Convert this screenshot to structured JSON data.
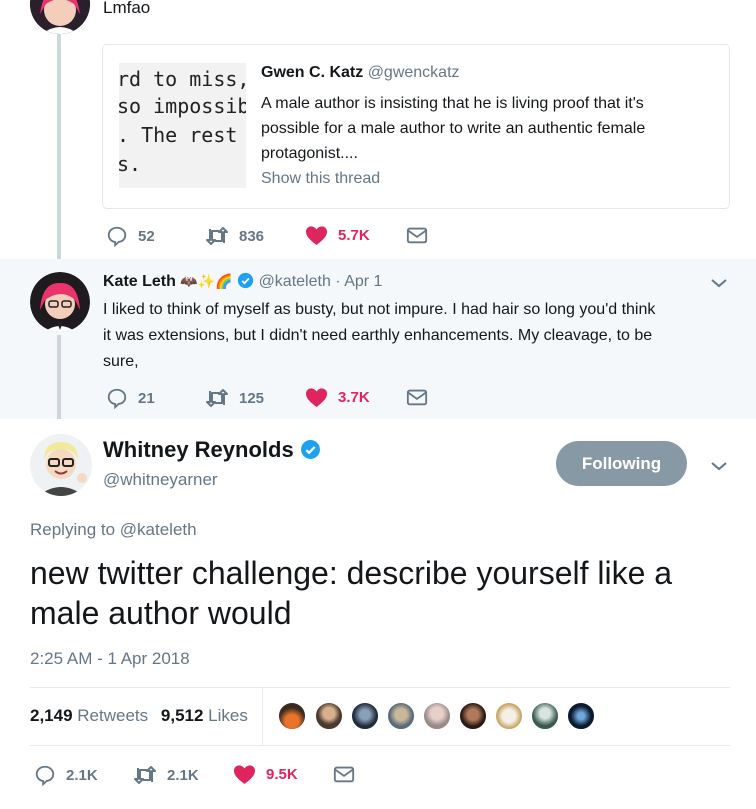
{
  "top_tweet": {
    "text": "Lmfao",
    "quote": {
      "image_lines": [
        "rd to miss, I",
        "so impossibly",
        ". The rest o",
        "s."
      ],
      "author_name": "Gwen C. Katz",
      "author_handle": "@gwenckatz",
      "text_lines": [
        "A male author is insisting that he is living proof that it's",
        "possible for a male author to write an authentic female",
        "protagonist...."
      ],
      "show_thread": "Show this thread"
    },
    "actions": {
      "replies": "52",
      "retweets": "836",
      "likes": "5.7K"
    }
  },
  "kate_tweet": {
    "name": "Kate Leth",
    "name_emoji": "🦇✨🌈",
    "handle": "@kateleth",
    "date": "· Apr 1",
    "text_lines": [
      "I liked to think of myself as busty, but not impure. I had hair so long you'd think",
      "it was extensions, but I didn't need earthly enhancements. My cleavage, to be",
      "sure,"
    ],
    "actions": {
      "replies": "21",
      "retweets": "125",
      "likes": "3.7K"
    }
  },
  "main_tweet": {
    "name": "Whitney Reynolds",
    "handle": "@whitneyarner",
    "follow_label": "Following",
    "replying_prefix": "Replying to ",
    "replying_to": "@kateleth",
    "text_lines": [
      "new twitter challenge: describe yourself like a",
      "male author would"
    ],
    "timestamp": "2:25 AM - 1 Apr 2018",
    "stats": {
      "retweets_count": "2,149",
      "retweets_label": "Retweets",
      "likes_count": "9,512",
      "likes_label": "Likes"
    },
    "actions": {
      "replies": "2.1K",
      "retweets": "2.1K",
      "likes": "9.5K"
    }
  },
  "colors": {
    "heart": "#e0245e",
    "verified": "#1da1f2",
    "muted": "#657786",
    "follow_button": "#8899a6"
  }
}
